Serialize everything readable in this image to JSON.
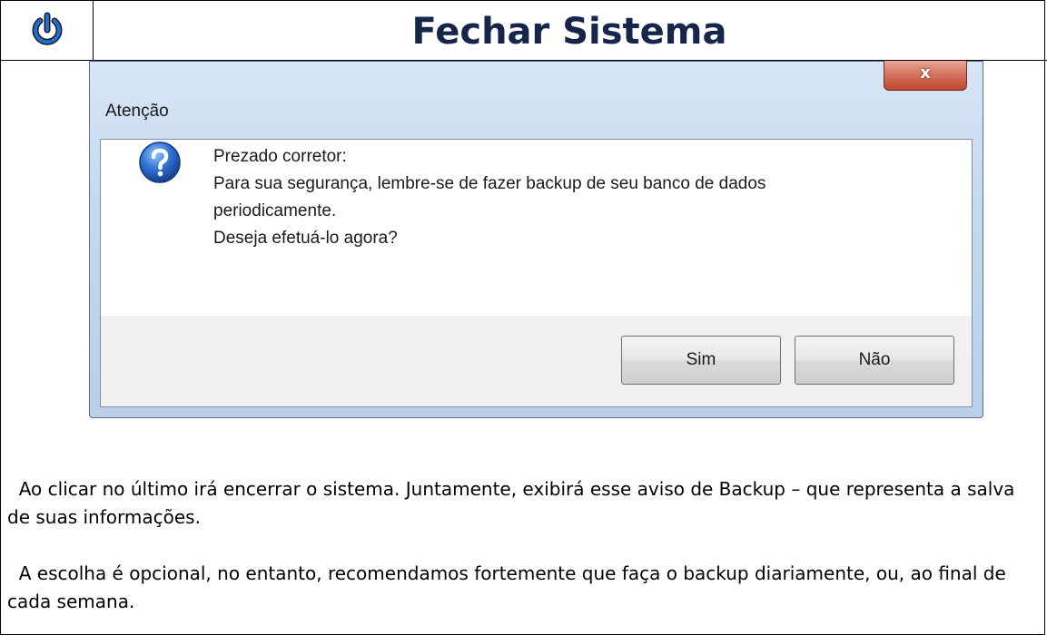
{
  "header": {
    "icon": "power-icon",
    "title": "Fechar Sistema"
  },
  "dialog": {
    "title": "Atenção",
    "close_label": "x",
    "icon": "question-icon",
    "message_lines": [
      "Prezado corretor:",
      "Para sua segurança, lembre-se de fazer backup de seu banco de dados",
      "periodicamente.",
      "Deseja efetuá-lo agora?"
    ],
    "buttons": {
      "yes": "Sim",
      "no": "Não"
    }
  },
  "body": {
    "paragraph1": "  Ao clicar no último irá encerrar o sistema. Juntamente, exibirá esse aviso de Backup – que representa a salva de suas informações.",
    "paragraph2": "  A escolha é opcional, no entanto, recomendamos fortemente que faça o backup diariamente, ou, ao final de cada semana."
  },
  "colors": {
    "title": "#16264a",
    "power_icon": "#1f6fd1",
    "close_button": "#c9503a"
  }
}
